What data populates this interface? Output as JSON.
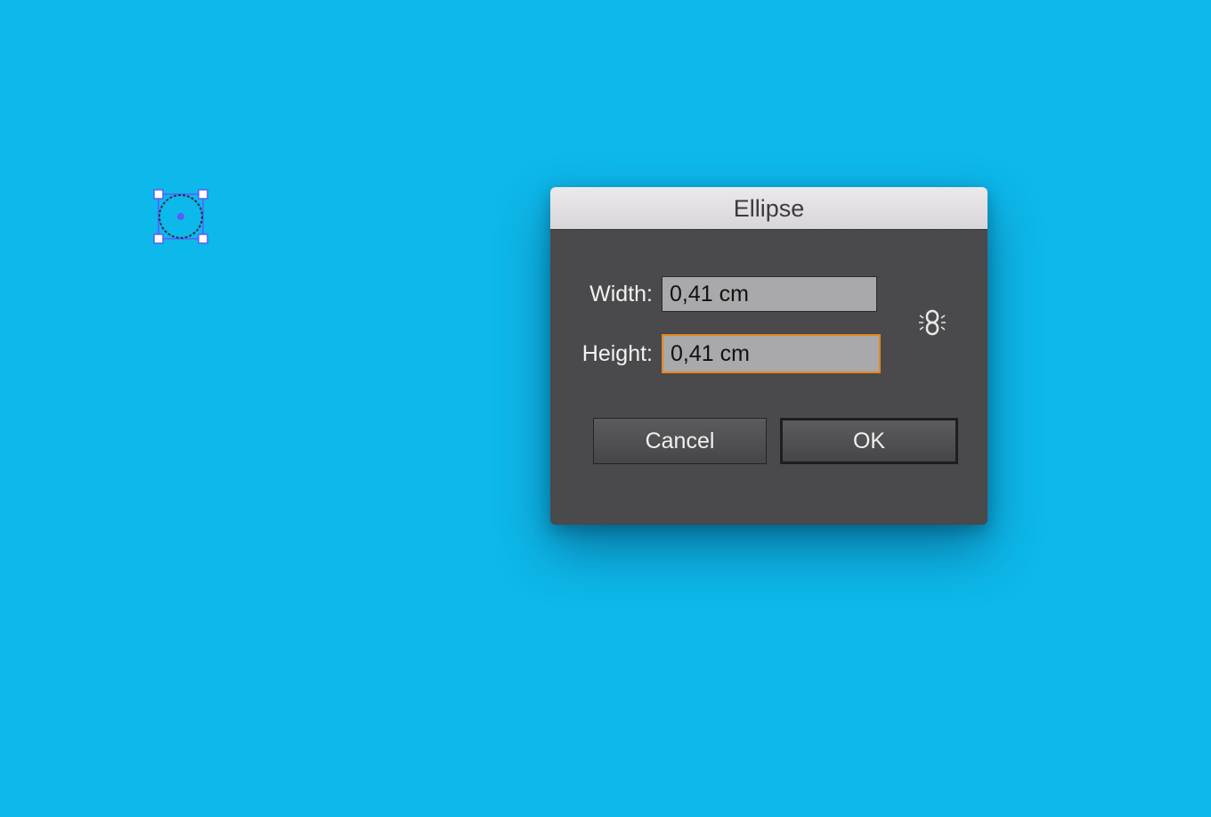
{
  "canvas": {
    "background_color": "#0db8ea",
    "selected_object": "ellipse"
  },
  "dialog": {
    "title": "Ellipse",
    "width": {
      "label": "Width:",
      "value": "0,41 cm"
    },
    "height": {
      "label": "Height:",
      "value": "0,41 cm",
      "focused": true
    },
    "constrain_icon": "link-proportions-icon",
    "buttons": {
      "cancel_label": "Cancel",
      "ok_label": "OK"
    },
    "colors": {
      "panel": "#4a494b",
      "focus_ring": "#e5861f",
      "selection": "#5b5bff"
    }
  }
}
